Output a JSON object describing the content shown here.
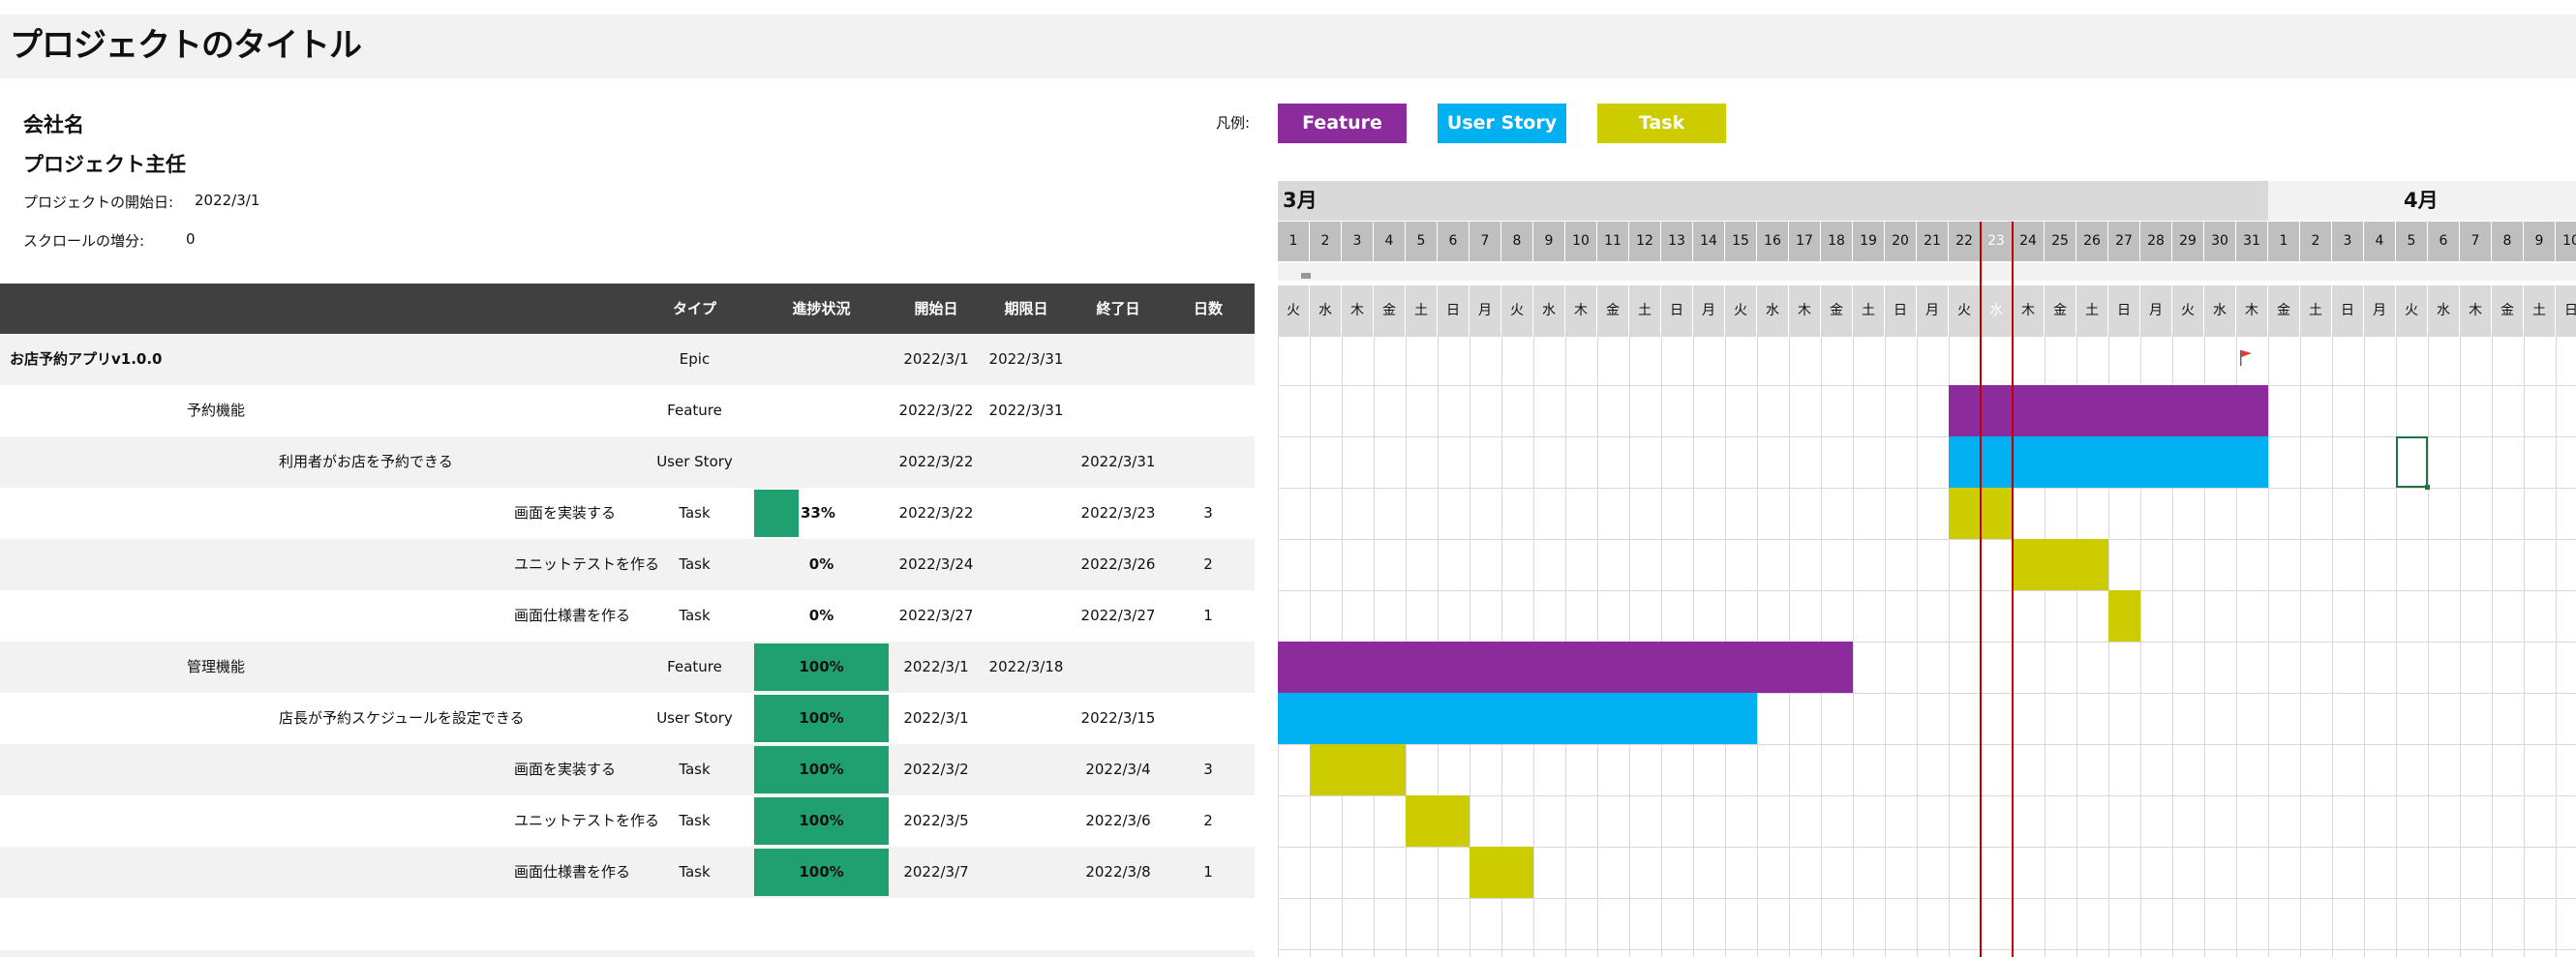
{
  "title": "プロジェクトのタイトル",
  "company": "会社名",
  "manager": "プロジェクト主任",
  "project_start": {
    "label": "プロジェクトの開始日:",
    "value": "2022/3/1"
  },
  "scroll_increment": {
    "label": "スクロールの増分:",
    "value": "0"
  },
  "legend": {
    "label": "凡例:",
    "items": [
      {
        "label": "Feature",
        "color": "#8b2b9c"
      },
      {
        "label": "User Story",
        "color": "#00b0f0"
      },
      {
        "label": "Task",
        "color": "#cccc00"
      }
    ]
  },
  "columns": {
    "type": "タイプ",
    "progress": "進捗状況",
    "start": "開始日",
    "due": "期限日",
    "end": "終了日",
    "days": "日数"
  },
  "colors": {
    "feature": "#8b2b9c",
    "user_story": "#00b0f0",
    "task": "#cccc00",
    "progress": "#20a070",
    "today_line": "#c00000"
  },
  "rows": [
    {
      "name": "お店予約アプリv1.0.0",
      "level": 0,
      "type": "Epic",
      "progress": null,
      "start": "2022/3/1",
      "due": "2022/3/31",
      "end": "",
      "days": ""
    },
    {
      "name": "予約機能",
      "level": 1,
      "type": "Feature",
      "progress": null,
      "start": "2022/3/22",
      "due": "2022/3/31",
      "end": "",
      "days": ""
    },
    {
      "name": "利用者がお店を予約できる",
      "level": 2,
      "type": "User Story",
      "progress": null,
      "start": "2022/3/22",
      "due": "",
      "end": "2022/3/31",
      "days": ""
    },
    {
      "name": "画面を実装する",
      "level": 3,
      "type": "Task",
      "progress": 0.33,
      "progress_label": "33%",
      "start": "2022/3/22",
      "due": "",
      "end": "2022/3/23",
      "days": "3"
    },
    {
      "name": "ユニットテストを作る",
      "level": 3,
      "type": "Task",
      "progress": 0,
      "progress_label": "0%",
      "start": "2022/3/24",
      "due": "",
      "end": "2022/3/26",
      "days": "2"
    },
    {
      "name": "画面仕様書を作る",
      "level": 3,
      "type": "Task",
      "progress": 0,
      "progress_label": "0%",
      "start": "2022/3/27",
      "due": "",
      "end": "2022/3/27",
      "days": "1"
    },
    {
      "name": "管理機能",
      "level": 1,
      "type": "Feature",
      "progress": 1,
      "progress_label": "100%",
      "start": "2022/3/1",
      "due": "2022/3/18",
      "end": "",
      "days": ""
    },
    {
      "name": "店長が予約スケジュールを設定できる",
      "level": 2,
      "type": "User Story",
      "progress": 1,
      "progress_label": "100%",
      "start": "2022/3/1",
      "due": "",
      "end": "2022/3/15",
      "days": ""
    },
    {
      "name": "画面を実装する",
      "level": 3,
      "type": "Task",
      "progress": 1,
      "progress_label": "100%",
      "start": "2022/3/2",
      "due": "",
      "end": "2022/3/4",
      "days": "3"
    },
    {
      "name": "ユニットテストを作る",
      "level": 3,
      "type": "Task",
      "progress": 1,
      "progress_label": "100%",
      "start": "2022/3/5",
      "due": "",
      "end": "2022/3/6",
      "days": "2"
    },
    {
      "name": "画面仕様書を作る",
      "level": 3,
      "type": "Task",
      "progress": 1,
      "progress_label": "100%",
      "start": "2022/3/7",
      "due": "",
      "end": "2022/3/8",
      "days": "1"
    }
  ],
  "gantt": {
    "months": [
      {
        "label": "3月",
        "start_day_index": 0,
        "days": 31
      },
      {
        "label": "4月",
        "start_day_index": 31,
        "days": 10
      }
    ],
    "days": [
      "1",
      "2",
      "3",
      "4",
      "5",
      "6",
      "7",
      "8",
      "9",
      "10",
      "11",
      "12",
      "13",
      "14",
      "15",
      "16",
      "17",
      "18",
      "19",
      "20",
      "21",
      "22",
      "23",
      "24",
      "25",
      "26",
      "27",
      "28",
      "29",
      "30",
      "31",
      "1",
      "2",
      "3",
      "4",
      "5",
      "6",
      "7",
      "8",
      "9",
      "10"
    ],
    "weekdays": [
      "火",
      "水",
      "木",
      "金",
      "土",
      "日",
      "月",
      "火",
      "水",
      "木",
      "金",
      "土",
      "日",
      "月",
      "火",
      "水",
      "木",
      "金",
      "土",
      "日",
      "月",
      "火",
      "水",
      "木",
      "金",
      "土",
      "日",
      "月",
      "火",
      "水",
      "木",
      "金",
      "土",
      "日",
      "月",
      "火",
      "水",
      "木",
      "金",
      "土",
      "日"
    ],
    "today_index": 22,
    "bars": [
      {
        "row": 1,
        "start_index": 21,
        "end_index": 30,
        "kind": "feature"
      },
      {
        "row": 2,
        "start_index": 21,
        "end_index": 30,
        "kind": "user_story"
      },
      {
        "row": 3,
        "start_index": 21,
        "end_index": 22,
        "kind": "task"
      },
      {
        "row": 4,
        "start_index": 23,
        "end_index": 25,
        "kind": "task"
      },
      {
        "row": 5,
        "start_index": 26,
        "end_index": 26,
        "kind": "task"
      },
      {
        "row": 6,
        "start_index": 0,
        "end_index": 17,
        "kind": "feature"
      },
      {
        "row": 7,
        "start_index": 0,
        "end_index": 14,
        "kind": "user_story"
      },
      {
        "row": 8,
        "start_index": 1,
        "end_index": 3,
        "kind": "task"
      },
      {
        "row": 9,
        "start_index": 4,
        "end_index": 5,
        "kind": "task"
      },
      {
        "row": 10,
        "start_index": 6,
        "end_index": 7,
        "kind": "task"
      }
    ],
    "milestone_flag": {
      "row": 0,
      "day_index": 30
    },
    "selected_cell": {
      "row": 2,
      "day_index": 35
    }
  }
}
